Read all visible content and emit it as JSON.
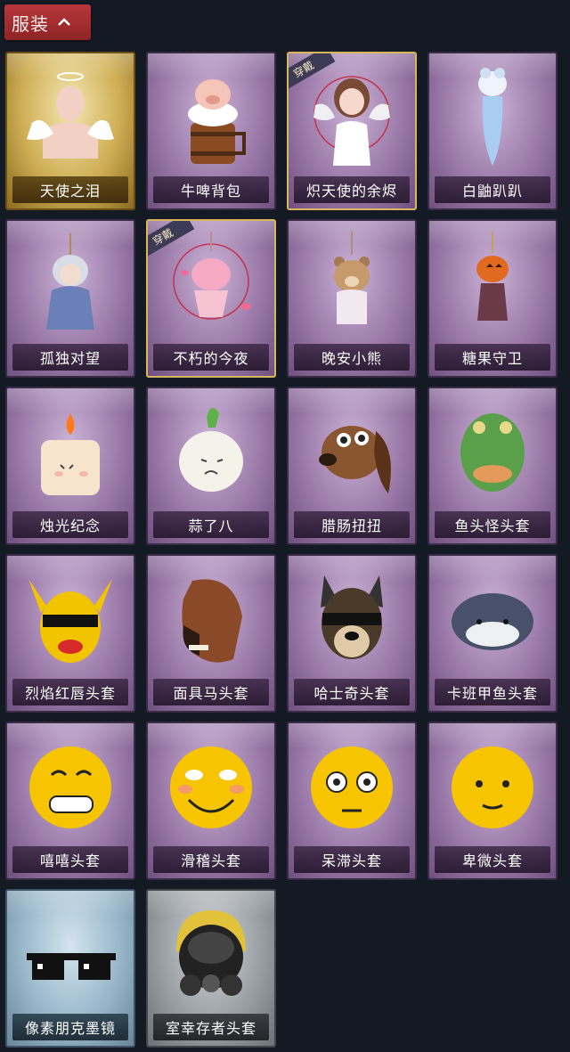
{
  "header": {
    "title": "服装"
  },
  "items": [
    {
      "label": "天使之泪",
      "style": "gold",
      "equipped": false,
      "icon": "angel-halo-icon"
    },
    {
      "label": "牛啤背包",
      "style": "purple",
      "equipped": false,
      "icon": "pig-beer-barrel-icon"
    },
    {
      "label": "炽天使的余烬",
      "style": "purple",
      "equipped": true,
      "badge": "穿戴",
      "icon": "angel-girl-icon"
    },
    {
      "label": "白鼬趴趴",
      "style": "purple",
      "equipped": false,
      "icon": "white-ermine-icon"
    },
    {
      "label": "孤独对望",
      "style": "purple",
      "equipped": false,
      "icon": "doll-charm-icon"
    },
    {
      "label": "不朽的今夜",
      "style": "purple",
      "equipped": true,
      "badge": "穿戴",
      "icon": "pink-cat-bowl-icon"
    },
    {
      "label": "晚安小熊",
      "style": "purple",
      "equipped": false,
      "icon": "bear-charm-icon"
    },
    {
      "label": "糖果守卫",
      "style": "purple",
      "equipped": false,
      "icon": "pumpkin-charm-icon"
    },
    {
      "label": "烛光纪念",
      "style": "purple",
      "equipped": false,
      "icon": "candle-icon"
    },
    {
      "label": "蒜了八",
      "style": "purple",
      "equipped": false,
      "icon": "garlic-icon"
    },
    {
      "label": "腊肠扭扭",
      "style": "purple",
      "equipped": false,
      "icon": "dachshund-mask-icon"
    },
    {
      "label": "鱼头怪头套",
      "style": "purple",
      "equipped": false,
      "icon": "fish-mask-icon"
    },
    {
      "label": "烈焰红唇头套",
      "style": "purple",
      "equipped": false,
      "icon": "yellow-mask-sunglasses-icon"
    },
    {
      "label": "面具马头套",
      "style": "purple",
      "equipped": false,
      "icon": "horse-mask-icon"
    },
    {
      "label": "哈士奇头套",
      "style": "purple",
      "equipped": false,
      "icon": "husky-mask-icon"
    },
    {
      "label": "卡班甲鱼头套",
      "style": "purple",
      "equipped": false,
      "icon": "round-fish-mask-icon"
    },
    {
      "label": "嘻嘻头套",
      "style": "purple",
      "equipped": false,
      "icon": "grin-emoji-mask-icon"
    },
    {
      "label": "滑稽头套",
      "style": "purple",
      "equipped": false,
      "icon": "funny-emoji-mask-icon"
    },
    {
      "label": "呆滞头套",
      "style": "purple",
      "equipped": false,
      "icon": "stare-emoji-mask-icon"
    },
    {
      "label": "卑微头套",
      "style": "purple",
      "equipped": false,
      "icon": "humble-emoji-mask-icon"
    },
    {
      "label": "像素朋克墨镜",
      "style": "blue",
      "equipped": false,
      "icon": "pixel-sunglasses-icon"
    },
    {
      "label": "室幸存者头套",
      "style": "grey",
      "equipped": false,
      "icon": "gas-mask-helmet-icon"
    }
  ]
}
